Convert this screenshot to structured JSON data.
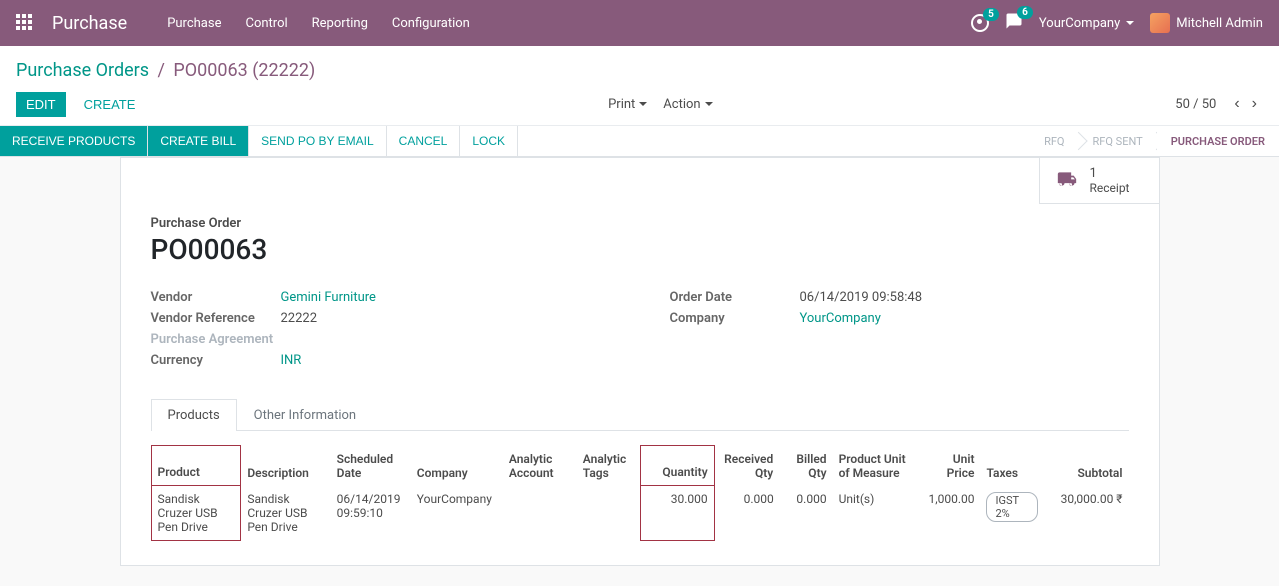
{
  "nav": {
    "brand": "Purchase",
    "menu": [
      "Purchase",
      "Control",
      "Reporting",
      "Configuration"
    ],
    "activity_count": "5",
    "messages_count": "6",
    "company": "YourCompany",
    "user": "Mitchell Admin"
  },
  "breadcrumb": {
    "parent": "Purchase Orders",
    "current": "PO00063 (22222)"
  },
  "buttons": {
    "edit": "EDIT",
    "create": "CREATE",
    "print": "Print",
    "action": "Action",
    "receive_products": "RECEIVE PRODUCTS",
    "create_bill": "CREATE BILL",
    "send_po": "SEND PO BY EMAIL",
    "cancel": "CANCEL",
    "lock": "LOCK"
  },
  "pager": {
    "text": "50 / 50"
  },
  "status": {
    "rfq": "RFQ",
    "rfq_sent": "RFQ SENT",
    "purchase_order": "PURCHASE ORDER"
  },
  "stat_button": {
    "value": "1",
    "text": "Receipt"
  },
  "form": {
    "title_label": "Purchase Order",
    "po_number": "PO00063",
    "labels": {
      "vendor": "Vendor",
      "vendor_ref": "Vendor Reference",
      "purchase_agreement": "Purchase Agreement",
      "currency": "Currency",
      "order_date": "Order Date",
      "company": "Company"
    },
    "values": {
      "vendor": "Gemini Furniture",
      "vendor_ref": "22222",
      "currency": "INR",
      "order_date": "06/14/2019 09:58:48",
      "company": "YourCompany"
    }
  },
  "tabs": {
    "products": "Products",
    "other": "Other Information"
  },
  "table": {
    "headers": {
      "product": "Product",
      "description": "Description",
      "scheduled_date": "Scheduled Date",
      "company": "Company",
      "analytic_account": "Analytic Account",
      "analytic_tags": "Analytic Tags",
      "quantity": "Quantity",
      "received_qty": "Received Qty",
      "billed_qty": "Billed Qty",
      "uom": "Product Unit of Measure",
      "unit_price": "Unit Price",
      "taxes": "Taxes",
      "subtotal": "Subtotal"
    },
    "rows": [
      {
        "product": "Sandisk Cruzer USB Pen Drive",
        "description": "Sandisk Cruzer USB Pen Drive",
        "scheduled_date": "06/14/2019 09:59:10",
        "company": "YourCompany",
        "analytic_account": "",
        "analytic_tags": "",
        "quantity": "30.000",
        "received_qty": "0.000",
        "billed_qty": "0.000",
        "uom": "Unit(s)",
        "unit_price": "1,000.00",
        "taxes": "IGST 2%",
        "subtotal": "30,000.00 ₹"
      }
    ]
  }
}
